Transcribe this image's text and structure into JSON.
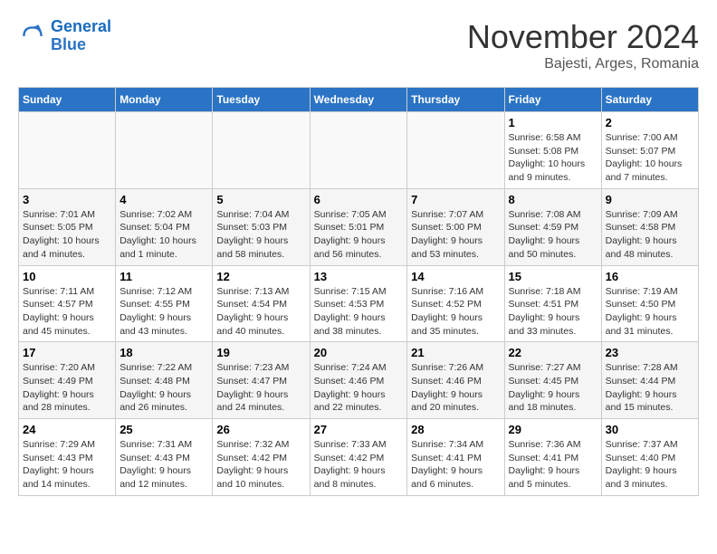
{
  "logo": {
    "text_general": "General",
    "text_blue": "Blue"
  },
  "header": {
    "month": "November 2024",
    "location": "Bajesti, Arges, Romania"
  },
  "weekdays": [
    "Sunday",
    "Monday",
    "Tuesday",
    "Wednesday",
    "Thursday",
    "Friday",
    "Saturday"
  ],
  "weeks": [
    [
      {
        "day": "",
        "info": ""
      },
      {
        "day": "",
        "info": ""
      },
      {
        "day": "",
        "info": ""
      },
      {
        "day": "",
        "info": ""
      },
      {
        "day": "",
        "info": ""
      },
      {
        "day": "1",
        "info": "Sunrise: 6:58 AM\nSunset: 5:08 PM\nDaylight: 10 hours and 9 minutes."
      },
      {
        "day": "2",
        "info": "Sunrise: 7:00 AM\nSunset: 5:07 PM\nDaylight: 10 hours and 7 minutes."
      }
    ],
    [
      {
        "day": "3",
        "info": "Sunrise: 7:01 AM\nSunset: 5:05 PM\nDaylight: 10 hours and 4 minutes."
      },
      {
        "day": "4",
        "info": "Sunrise: 7:02 AM\nSunset: 5:04 PM\nDaylight: 10 hours and 1 minute."
      },
      {
        "day": "5",
        "info": "Sunrise: 7:04 AM\nSunset: 5:03 PM\nDaylight: 9 hours and 58 minutes."
      },
      {
        "day": "6",
        "info": "Sunrise: 7:05 AM\nSunset: 5:01 PM\nDaylight: 9 hours and 56 minutes."
      },
      {
        "day": "7",
        "info": "Sunrise: 7:07 AM\nSunset: 5:00 PM\nDaylight: 9 hours and 53 minutes."
      },
      {
        "day": "8",
        "info": "Sunrise: 7:08 AM\nSunset: 4:59 PM\nDaylight: 9 hours and 50 minutes."
      },
      {
        "day": "9",
        "info": "Sunrise: 7:09 AM\nSunset: 4:58 PM\nDaylight: 9 hours and 48 minutes."
      }
    ],
    [
      {
        "day": "10",
        "info": "Sunrise: 7:11 AM\nSunset: 4:57 PM\nDaylight: 9 hours and 45 minutes."
      },
      {
        "day": "11",
        "info": "Sunrise: 7:12 AM\nSunset: 4:55 PM\nDaylight: 9 hours and 43 minutes."
      },
      {
        "day": "12",
        "info": "Sunrise: 7:13 AM\nSunset: 4:54 PM\nDaylight: 9 hours and 40 minutes."
      },
      {
        "day": "13",
        "info": "Sunrise: 7:15 AM\nSunset: 4:53 PM\nDaylight: 9 hours and 38 minutes."
      },
      {
        "day": "14",
        "info": "Sunrise: 7:16 AM\nSunset: 4:52 PM\nDaylight: 9 hours and 35 minutes."
      },
      {
        "day": "15",
        "info": "Sunrise: 7:18 AM\nSunset: 4:51 PM\nDaylight: 9 hours and 33 minutes."
      },
      {
        "day": "16",
        "info": "Sunrise: 7:19 AM\nSunset: 4:50 PM\nDaylight: 9 hours and 31 minutes."
      }
    ],
    [
      {
        "day": "17",
        "info": "Sunrise: 7:20 AM\nSunset: 4:49 PM\nDaylight: 9 hours and 28 minutes."
      },
      {
        "day": "18",
        "info": "Sunrise: 7:22 AM\nSunset: 4:48 PM\nDaylight: 9 hours and 26 minutes."
      },
      {
        "day": "19",
        "info": "Sunrise: 7:23 AM\nSunset: 4:47 PM\nDaylight: 9 hours and 24 minutes."
      },
      {
        "day": "20",
        "info": "Sunrise: 7:24 AM\nSunset: 4:46 PM\nDaylight: 9 hours and 22 minutes."
      },
      {
        "day": "21",
        "info": "Sunrise: 7:26 AM\nSunset: 4:46 PM\nDaylight: 9 hours and 20 minutes."
      },
      {
        "day": "22",
        "info": "Sunrise: 7:27 AM\nSunset: 4:45 PM\nDaylight: 9 hours and 18 minutes."
      },
      {
        "day": "23",
        "info": "Sunrise: 7:28 AM\nSunset: 4:44 PM\nDaylight: 9 hours and 15 minutes."
      }
    ],
    [
      {
        "day": "24",
        "info": "Sunrise: 7:29 AM\nSunset: 4:43 PM\nDaylight: 9 hours and 14 minutes."
      },
      {
        "day": "25",
        "info": "Sunrise: 7:31 AM\nSunset: 4:43 PM\nDaylight: 9 hours and 12 minutes."
      },
      {
        "day": "26",
        "info": "Sunrise: 7:32 AM\nSunset: 4:42 PM\nDaylight: 9 hours and 10 minutes."
      },
      {
        "day": "27",
        "info": "Sunrise: 7:33 AM\nSunset: 4:42 PM\nDaylight: 9 hours and 8 minutes."
      },
      {
        "day": "28",
        "info": "Sunrise: 7:34 AM\nSunset: 4:41 PM\nDaylight: 9 hours and 6 minutes."
      },
      {
        "day": "29",
        "info": "Sunrise: 7:36 AM\nSunset: 4:41 PM\nDaylight: 9 hours and 5 minutes."
      },
      {
        "day": "30",
        "info": "Sunrise: 7:37 AM\nSunset: 4:40 PM\nDaylight: 9 hours and 3 minutes."
      }
    ]
  ]
}
